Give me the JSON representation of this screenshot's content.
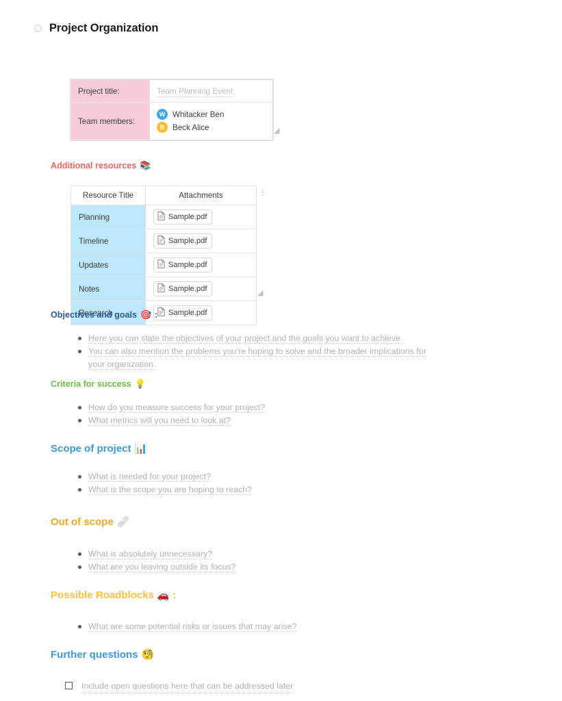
{
  "document": {
    "title": "Project Organization",
    "title_bullet_icon": "radio-circle-icon"
  },
  "project_table": {
    "rows": [
      {
        "label": "Project title:",
        "value": "Team Planning Event"
      },
      {
        "label": "Team members:"
      }
    ],
    "members": [
      {
        "initial": "W",
        "name": "Whitacker Ben",
        "color": "#41A5EE"
      },
      {
        "initial": "B",
        "name": "Beck Alice",
        "color": "#FBBC34"
      }
    ],
    "resize_handle_icon": "resize-corner-icon"
  },
  "sections": {
    "additional_resources": {
      "heading": "Additional resources",
      "emoji": "📚",
      "emoji_name": "books-icon",
      "color": "#F4645F",
      "tail": ""
    },
    "objectives": {
      "heading": "Objectives and goals",
      "emoji": "🎯",
      "emoji_name": "dart-target-icon",
      "color": "#2B5A9B",
      "tail": ":",
      "items": [
        "Here you can state the objectives of your project and the goals you want to achieve.",
        "You can also mention the problems you're hoping to solve and the broader implications for your organization."
      ]
    },
    "criteria": {
      "heading": "Criteria for success",
      "emoji": "💡",
      "emoji_name": "lightbulb-icon",
      "color": "#6CBE45",
      "tail": "",
      "items": [
        "How do you measure success for your project?",
        "What metrics will you need to look at?"
      ]
    },
    "scope": {
      "heading": "Scope of project",
      "emoji": "📊",
      "emoji_name": "bar-chart-icon",
      "color": "#3A9BDC",
      "tail": "",
      "items": [
        "What is needed for your project?",
        "What is the scope you are hoping to reach?"
      ]
    },
    "out_of_scope": {
      "heading": "Out of scope",
      "emoji": "🩹",
      "emoji_name": "crossed-bandages-icon",
      "color": "#F5A623",
      "tail": "",
      "items": [
        "What is absolutely unnecessary?",
        "What are you leaving outside its focus?"
      ]
    },
    "roadblocks": {
      "heading": "Possible Roadblocks",
      "emoji": "🚗",
      "emoji_name": "car-icon",
      "color": "#FFC03A",
      "tail": ":",
      "items": [
        "What are some potential risks or issues that may arise?"
      ]
    },
    "further_questions": {
      "heading": "Further questions",
      "emoji": "🧐",
      "emoji_name": "monocle-face-icon",
      "color": "#3A9BDC",
      "tail": "",
      "checkbox_item": "Include open questions here that can be addressed later"
    }
  },
  "resource_table": {
    "columns": [
      "Resource Title",
      "Attachments"
    ],
    "rows": [
      {
        "title": "Planning",
        "attachment": "Sample.pdf"
      },
      {
        "title": "Timeline",
        "attachment": "Sample.pdf"
      },
      {
        "title": "Updates",
        "attachment": "Sample.pdf"
      },
      {
        "title": "Notes",
        "attachment": "Sample.pdf"
      },
      {
        "title": "Research",
        "attachment": "Sample.pdf"
      }
    ],
    "column_resize_icon": "column-resize-icon",
    "resize_handle_icon": "resize-corner-icon"
  }
}
